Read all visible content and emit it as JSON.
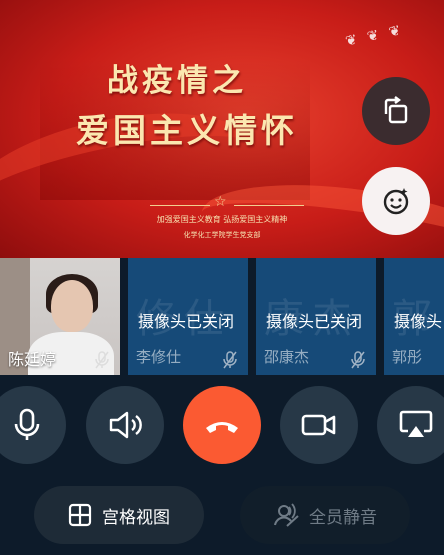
{
  "banner": {
    "title_line1": "战疫情之",
    "title_line2": "爱国主义情怀",
    "subtitle": "加强爱国主义教育  弘扬爱国主义精神",
    "organizer": "化学化工学院学生党支部"
  },
  "participants": [
    {
      "name": "陈廷婷",
      "camera_off_label": ""
    },
    {
      "name": "李修仕",
      "bg_name": "修仕",
      "camera_off_label": "摄像头已关闭"
    },
    {
      "name": "邵康杰",
      "bg_name": "康杰",
      "camera_off_label": "摄像头已关闭"
    },
    {
      "name": "郭彤",
      "bg_name": "郭",
      "camera_off_label": "摄像头"
    }
  ],
  "controls": {
    "grid_view_label": "宫格视图",
    "mute_all_label": "全员静音"
  },
  "colors": {
    "background": "#0d1b2a",
    "hangup": "#fb5a32",
    "camera_off_tile": "#164a78",
    "banner_red": "#c81d18"
  },
  "icons": [
    "rotate-screen-icon",
    "beauty-face-icon",
    "microphone-icon",
    "speaker-icon",
    "hang-up-icon",
    "video-camera-icon",
    "screen-share-icon",
    "grid-icon",
    "mute-all-icon",
    "mic-muted-icon"
  ]
}
